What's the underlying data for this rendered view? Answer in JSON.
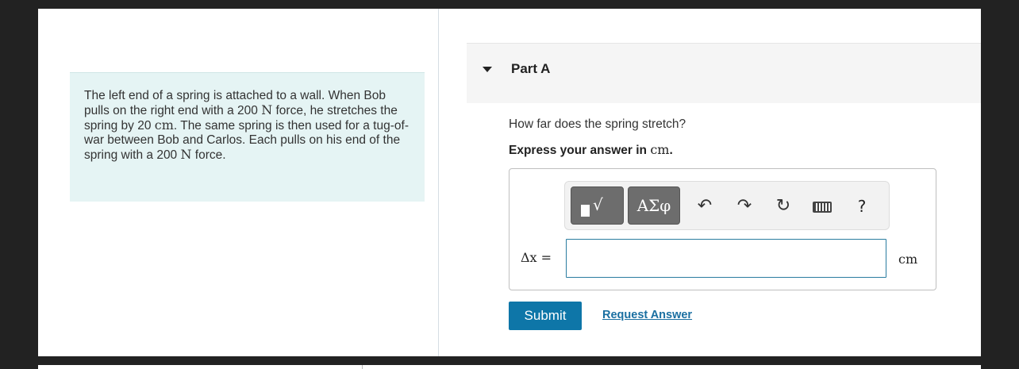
{
  "problem": {
    "text_1": "The left end of a spring is attached to a wall. When Bob pulls on the right end with a 200 ",
    "unit_N_1": "N",
    "text_2": " force, he stretches the spring by 20 ",
    "unit_cm": "cm",
    "text_3": ". The same spring is then used for a tug-of-war between Bob and Carlos. Each pulls on his end of the spring with a 200 ",
    "unit_N_2": "N",
    "text_4": " force."
  },
  "part": {
    "title": "Part A"
  },
  "question": {
    "prompt": "How far does the spring stretch?",
    "instruction_prefix": "Express your answer in ",
    "instruction_unit": "cm",
    "instruction_suffix": "."
  },
  "toolbar": {
    "templates_symbol": "√",
    "greek_label": "ΑΣφ",
    "undo_icon": "undo-icon",
    "redo_icon": "redo-icon",
    "reset_icon": "reset-icon",
    "keyboard_icon": "keyboard-icon",
    "help_label": "?"
  },
  "answer": {
    "variable_label": "Δx =",
    "value": "",
    "unit": "cm"
  },
  "actions": {
    "submit_label": "Submit",
    "request_label": "Request Answer"
  },
  "colors": {
    "submit": "#0e76a8",
    "problem_bg": "#e5f4f4",
    "input_border": "#2a7ca0"
  }
}
